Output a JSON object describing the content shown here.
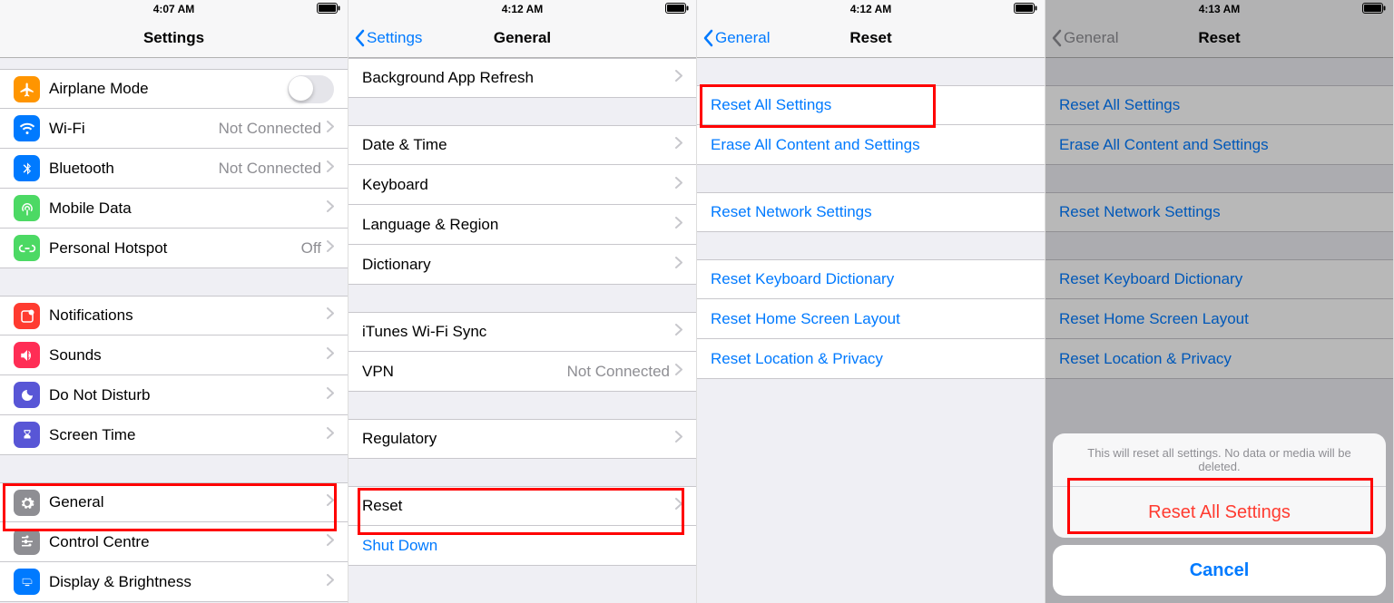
{
  "screen1": {
    "time": "4:07 AM",
    "title": "Settings",
    "rows": {
      "airplane": {
        "label": "Airplane Mode"
      },
      "wifi": {
        "label": "Wi-Fi",
        "value": "Not Connected"
      },
      "bluetooth": {
        "label": "Bluetooth",
        "value": "Not Connected"
      },
      "mobile": {
        "label": "Mobile Data"
      },
      "hotspot": {
        "label": "Personal Hotspot",
        "value": "Off"
      },
      "notifications": {
        "label": "Notifications"
      },
      "sounds": {
        "label": "Sounds"
      },
      "dnd": {
        "label": "Do Not Disturb"
      },
      "screentime": {
        "label": "Screen Time"
      },
      "general": {
        "label": "General"
      },
      "control": {
        "label": "Control Centre"
      },
      "display": {
        "label": "Display & Brightness"
      }
    }
  },
  "screen2": {
    "time": "4:12 AM",
    "back": "Settings",
    "title": "General",
    "rows": {
      "bgrefresh": {
        "label": "Background App Refresh"
      },
      "datetime": {
        "label": "Date & Time"
      },
      "keyboard": {
        "label": "Keyboard"
      },
      "language": {
        "label": "Language & Region"
      },
      "dictionary": {
        "label": "Dictionary"
      },
      "itunes": {
        "label": "iTunes Wi-Fi Sync"
      },
      "vpn": {
        "label": "VPN",
        "value": "Not Connected"
      },
      "regulatory": {
        "label": "Regulatory"
      },
      "reset": {
        "label": "Reset"
      },
      "shutdown": {
        "label": "Shut Down"
      }
    }
  },
  "screen3": {
    "time": "4:12 AM",
    "back": "General",
    "title": "Reset",
    "rows": {
      "all": {
        "label": "Reset All Settings"
      },
      "erase": {
        "label": "Erase All Content and Settings"
      },
      "network": {
        "label": "Reset Network Settings"
      },
      "kbdict": {
        "label": "Reset Keyboard Dictionary"
      },
      "home": {
        "label": "Reset Home Screen Layout"
      },
      "location": {
        "label": "Reset Location & Privacy"
      }
    }
  },
  "screen4": {
    "time": "4:13 AM",
    "back": "General",
    "title": "Reset",
    "rows": {
      "all": {
        "label": "Reset All Settings"
      },
      "erase": {
        "label": "Erase All Content and Settings"
      },
      "network": {
        "label": "Reset Network Settings"
      },
      "kbdict": {
        "label": "Reset Keyboard Dictionary"
      },
      "home": {
        "label": "Reset Home Screen Layout"
      },
      "location": {
        "label": "Reset Location & Privacy"
      }
    },
    "sheet": {
      "msg": "This will reset all settings. No data or media will be deleted.",
      "action": "Reset All Settings",
      "cancel": "Cancel"
    }
  }
}
